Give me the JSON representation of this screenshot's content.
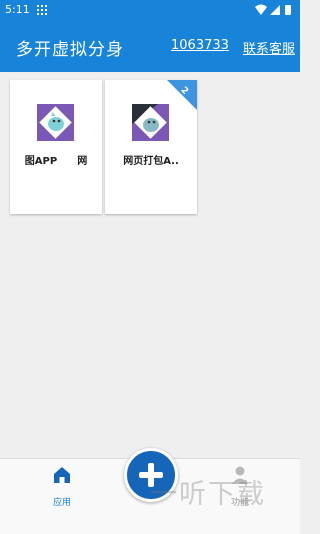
{
  "status_bar": {
    "time": "5:11"
  },
  "header": {
    "title": "多开虚拟分身",
    "account_id": "1063733",
    "contact": "联系客服"
  },
  "apps": [
    {
      "label": "图APP　　网"
    },
    {
      "label": "网页打包A..",
      "badge": "2"
    }
  ],
  "bottom_nav": {
    "apps_label": "应用",
    "func_label": "功能"
  },
  "watermark": {
    "text": "一听下载"
  },
  "colors": {
    "primary": "#1784d9",
    "fab": "#1565b8",
    "icon_bg": "#7b58b5",
    "badge": "#3d95df"
  }
}
